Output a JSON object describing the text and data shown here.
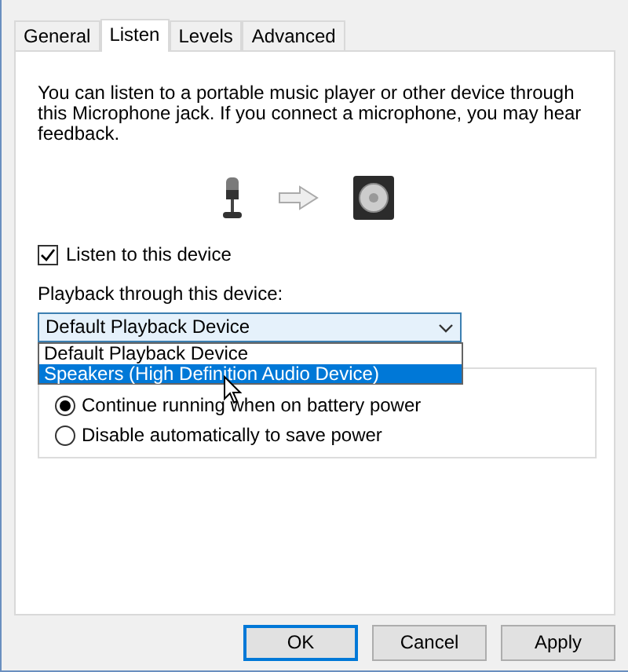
{
  "tabs": [
    {
      "label": "General",
      "selected": false
    },
    {
      "label": "Listen",
      "selected": true
    },
    {
      "label": "Levels",
      "selected": false
    },
    {
      "label": "Advanced",
      "selected": false
    }
  ],
  "description": "You can listen to a portable music player or other device through this Microphone jack.  If you connect a microphone, you may hear feedback.",
  "listen_checkbox": {
    "label": "Listen to this device",
    "checked": true
  },
  "playback": {
    "label": "Playback through this device:",
    "value": "Default Playback Device",
    "expanded": true,
    "options": [
      {
        "label": "Default Playback Device",
        "highlighted": false
      },
      {
        "label": "Speakers (High Definition Audio Device)",
        "highlighted": true
      }
    ]
  },
  "power_options": [
    {
      "label": "Continue running when on battery power",
      "selected": true
    },
    {
      "label": "Disable automatically to save power",
      "selected": false
    }
  ],
  "buttons": [
    {
      "label": "OK",
      "kind": "default"
    },
    {
      "label": "Cancel",
      "kind": "normal"
    },
    {
      "label": "Apply",
      "kind": "normal"
    }
  ]
}
